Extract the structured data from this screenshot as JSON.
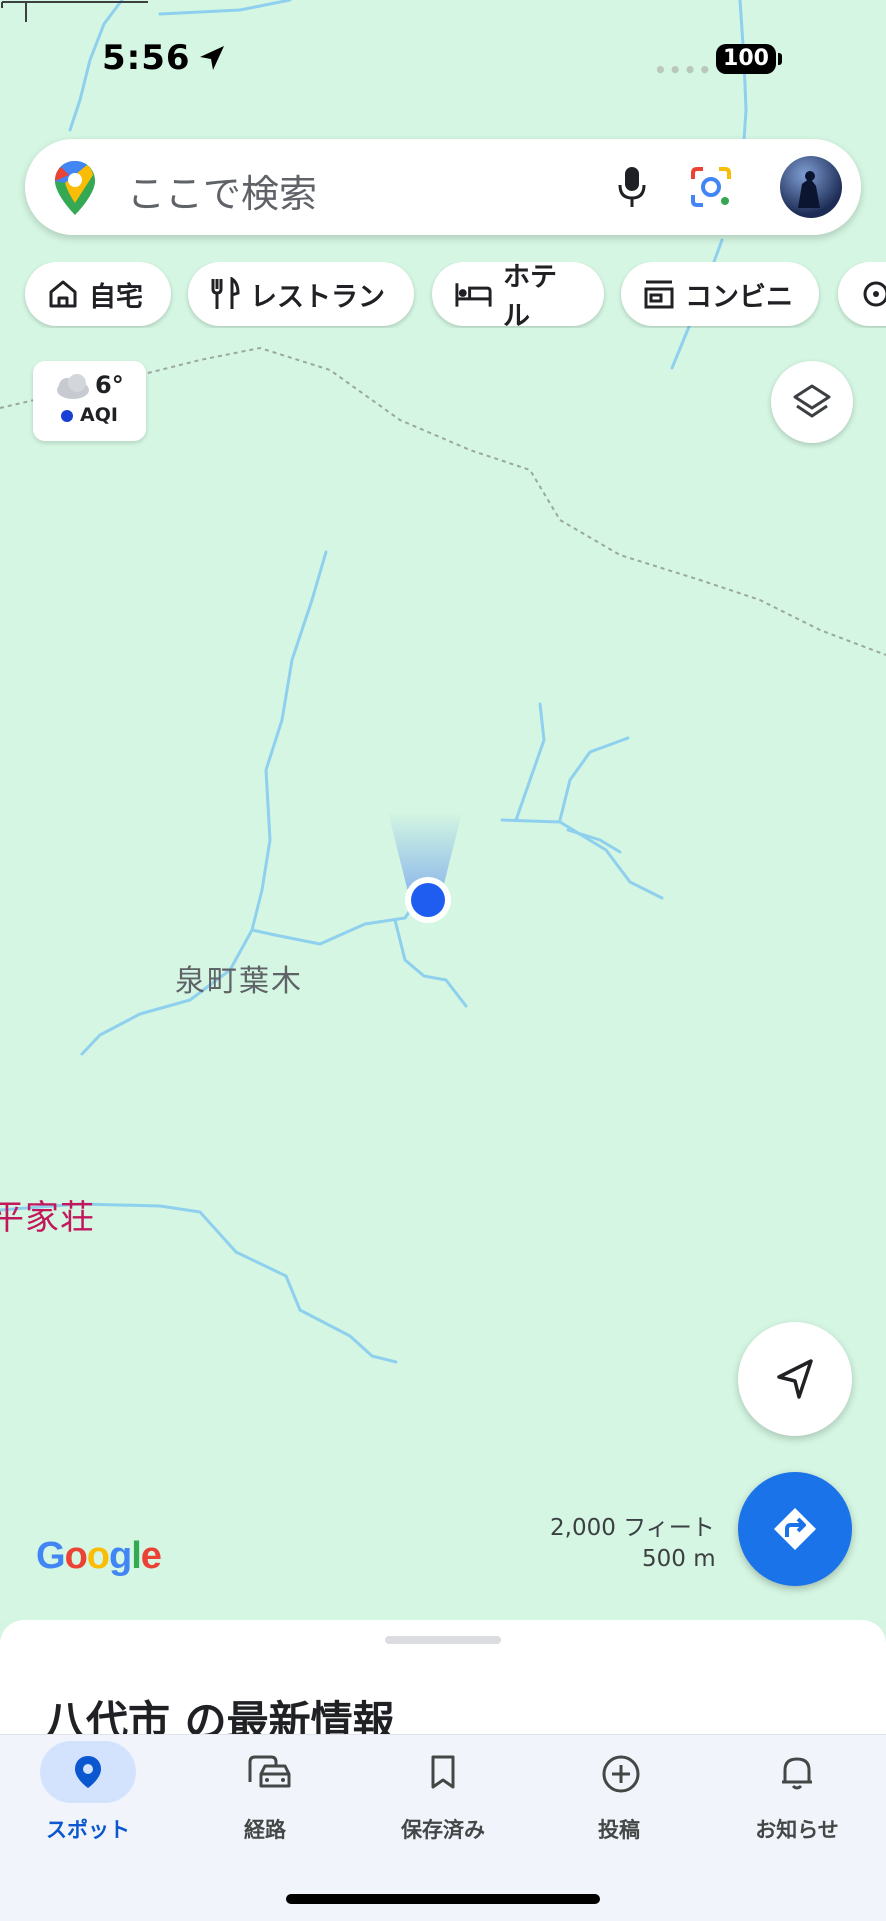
{
  "status_bar": {
    "time": "5:56",
    "battery": "100"
  },
  "search": {
    "placeholder": "ここで検索"
  },
  "chips": [
    {
      "label": "自宅",
      "icon": "home-icon"
    },
    {
      "label": "レストラン",
      "icon": "restaurant-icon"
    },
    {
      "label": "ホテル",
      "icon": "hotel-icon"
    },
    {
      "label": "コンビニ",
      "icon": "store-icon"
    }
  ],
  "weather": {
    "temperature": "6°",
    "aqi_label": "AQI"
  },
  "map": {
    "place_labels": [
      "泉町葉木",
      "平家荘"
    ],
    "scale_feet": "2,000 フィート",
    "scale_meters": "500 m",
    "logo": "Google"
  },
  "sheet": {
    "title": "八代市 の最新情報"
  },
  "bottom_nav": [
    {
      "label": "スポット",
      "icon": "location-pin-icon",
      "active": true
    },
    {
      "label": "経路",
      "icon": "commute-icon",
      "active": false
    },
    {
      "label": "保存済み",
      "icon": "bookmark-icon",
      "active": false
    },
    {
      "label": "投稿",
      "icon": "add-circle-icon",
      "active": false
    },
    {
      "label": "お知らせ",
      "icon": "bell-icon",
      "active": false
    }
  ],
  "colors": {
    "map_bg": "#d4f6e2",
    "water": "#8fd0ef",
    "accent": "#1a73e8",
    "pink_label": "#c2185b"
  }
}
